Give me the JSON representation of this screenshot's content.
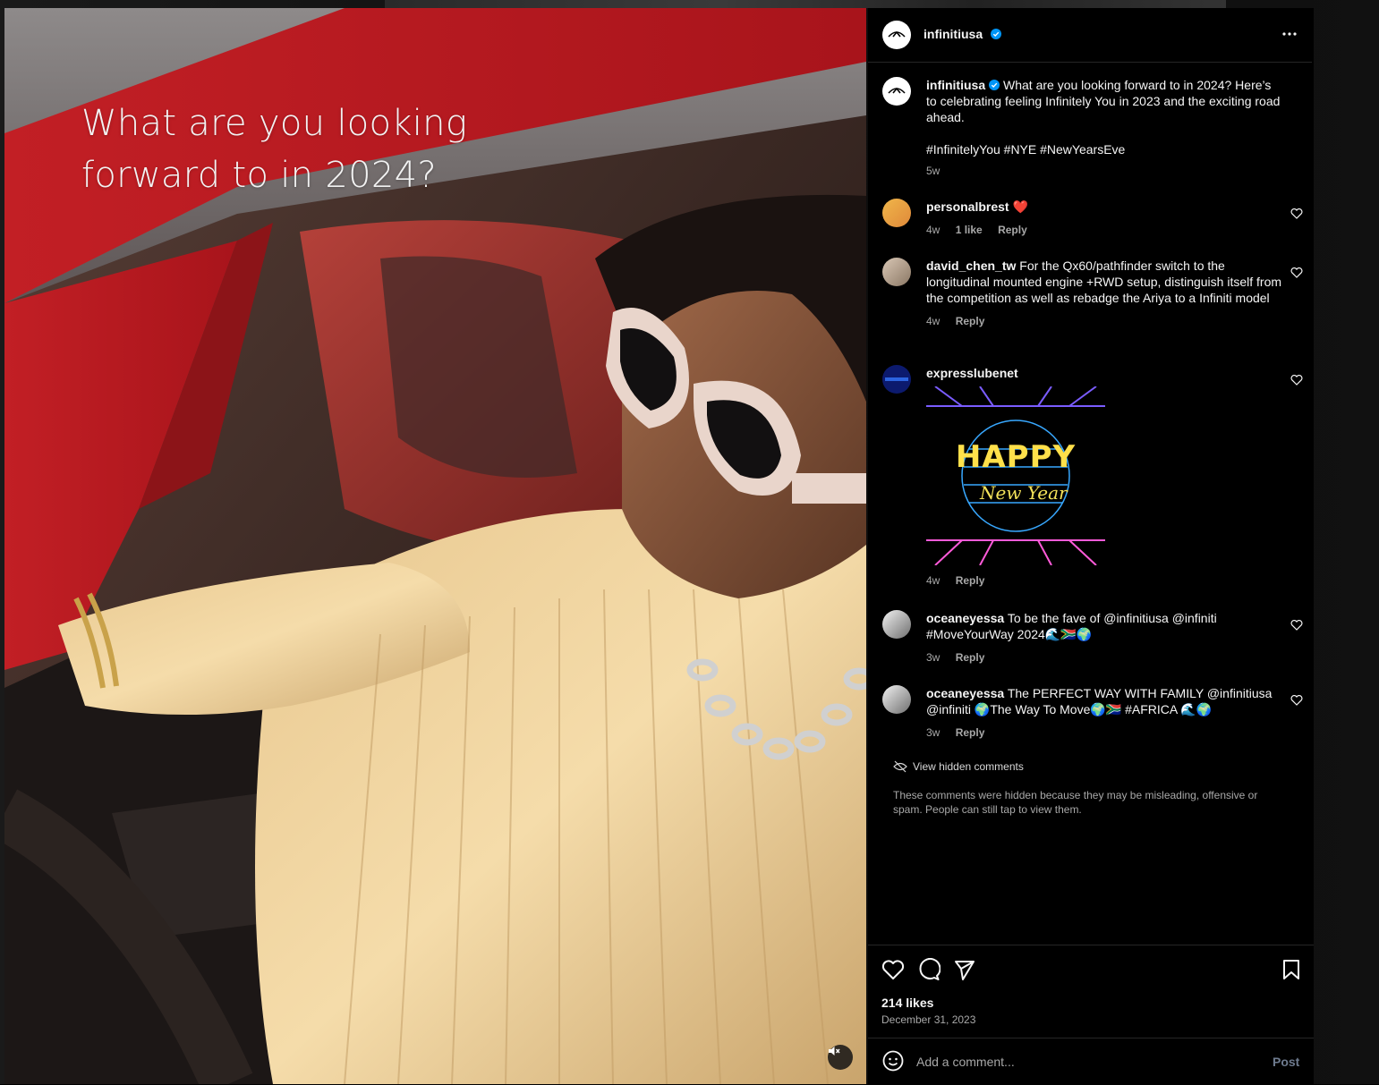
{
  "post": {
    "author": "infinitiusa",
    "media_caption_text": "What are you looking forward to in 2024?",
    "caption": {
      "author": "infinitiusa",
      "line1": "What are you looking forward to in 2024? Here’s to celebrating feeling Infinitely You in 2023 and the exciting road ahead.",
      "hashtags": "#InfinitelyYou #NYE #NewYearsEve",
      "time": "5w"
    },
    "likes": "214 likes",
    "date": "December 31, 2023"
  },
  "comments": [
    {
      "user": "personalbrest",
      "text": "❤️",
      "time": "4w",
      "likes": "1 like",
      "reply": "Reply"
    },
    {
      "user": "david_chen_tw",
      "text": "For the Qx60/pathfinder switch to the longitudinal mounted engine +RWD setup, distinguish itself from the competition as well as rebadge the Ariya to a Infiniti model",
      "time": "4w",
      "reply": "Reply"
    },
    {
      "user": "expresslubenet",
      "text": "",
      "gif_text_1": "HAPPY",
      "gif_text_2": "New Year",
      "time": "4w",
      "reply": "Reply"
    },
    {
      "user": "oceaneyessa",
      "text": "To be the fave of @infinitiusa @infiniti #MoveYourWay 2024🌊🇿🇦🌍",
      "time": "3w",
      "reply": "Reply"
    },
    {
      "user": "oceaneyessa",
      "text": "The PERFECT WAY WITH FAMILY @infinitiusa @infiniti 🌍The Way To Move🌍🇿🇦 #AFRICA 🌊🌍",
      "time": "3w",
      "reply": "Reply"
    }
  ],
  "hidden": {
    "link": "View hidden comments",
    "note": "These comments were hidden because they may be misleading, offensive or spam. People can still tap to view them."
  },
  "composer": {
    "placeholder": "Add a comment...",
    "post_label": "Post"
  },
  "icons": {
    "verified": "verified-badge-icon",
    "more": "more-options-icon",
    "like": "heart-icon",
    "comment": "comment-bubble-icon",
    "share": "paper-plane-icon",
    "save": "bookmark-icon",
    "emoji": "emoji-icon",
    "mute": "speaker-muted-icon",
    "hidden": "eye-off-icon"
  },
  "colors": {
    "background": "#000000",
    "text": "#f5f5f5",
    "muted": "#a8a8a8",
    "verified": "#0095f6",
    "post_button": "#6e7b8f"
  }
}
